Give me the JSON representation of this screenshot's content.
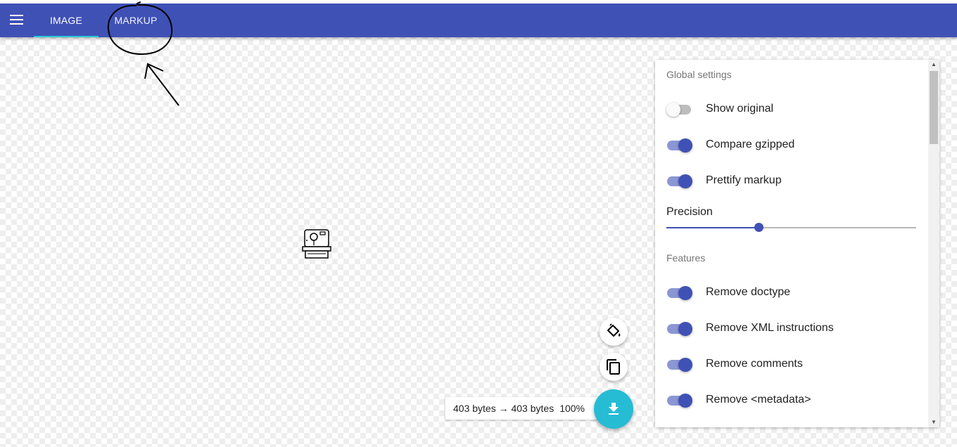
{
  "app": {
    "tabs": [
      {
        "label": "IMAGE",
        "active": true
      },
      {
        "label": "MARKUP",
        "active": false
      }
    ],
    "accent_color": "#3f51b5",
    "indicator_color": "#26c6da"
  },
  "settings": {
    "global_title": "Global settings",
    "show_original": {
      "label": "Show original",
      "on": false
    },
    "compare_gzipped": {
      "label": "Compare gzipped",
      "on": true
    },
    "prettify_markup": {
      "label": "Prettify markup",
      "on": true
    },
    "precision": {
      "label": "Precision",
      "fraction": 0.37
    },
    "features_title": "Features",
    "features": [
      {
        "label": "Remove doctype",
        "on": true
      },
      {
        "label": "Remove XML instructions",
        "on": true
      },
      {
        "label": "Remove comments",
        "on": true
      },
      {
        "label": "Remove <metadata>",
        "on": true
      }
    ]
  },
  "results": {
    "sizes": "403 bytes → 403 bytes",
    "percent": "100%"
  },
  "icons": {
    "menu": "menu-icon",
    "fill": "paint-bucket-icon",
    "copy": "copy-icon",
    "download": "download-icon",
    "preview": "instant-camera-icon"
  }
}
